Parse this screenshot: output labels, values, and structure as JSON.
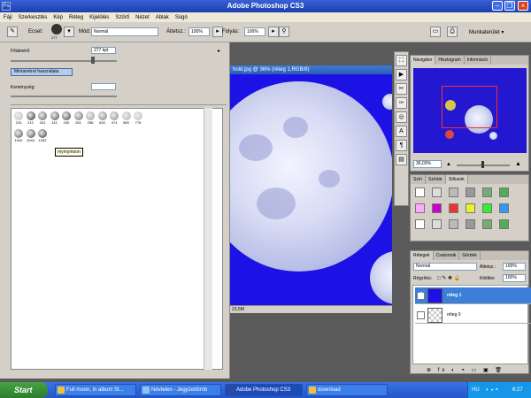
{
  "window": {
    "title": "Adobe Photoshop CS3",
    "app_icon": "Ps"
  },
  "menubar": [
    "Fájl",
    "Szerkesztés",
    "Kép",
    "Réteg",
    "Kijelölés",
    "Szűrő",
    "Nézet",
    "Ablak",
    "Súgó"
  ],
  "options": {
    "brush_label": "Ecset:",
    "brush_size": "277",
    "mode_label": "Mód:",
    "mode_value": "Normál",
    "opacity_label": "Áttetsz.:",
    "opacity_value": "100%",
    "flow_label": "Folyás:",
    "flow_value": "100%",
    "workspace_label": "Munkaterület ▾"
  },
  "brush_panel": {
    "diameter_label": "Főátmérő",
    "diameter_value": "277 kpt",
    "sample_button": "Mintaméret használata",
    "hardness_label": "Keménység:",
    "brushes": [
      "224",
      "212",
      "341",
      "311",
      "240",
      "261",
      "256",
      "640",
      "474",
      "560",
      "776",
      "1042",
      "1944",
      "1032"
    ],
    "tooltip": "mymymoon"
  },
  "document": {
    "title": "hold.jpg @ 36% (réteg 1,RGB/8)",
    "status": "23,5M"
  },
  "navigator": {
    "tabs": [
      "Navigátor",
      "Hisztogram",
      "Információ"
    ],
    "zoom": "36,03%"
  },
  "styles_panel": {
    "tabs": [
      "Szín",
      "Színtár",
      "Stílusok"
    ]
  },
  "layers": {
    "tabs": [
      "Rétegek",
      "Csatornák",
      "Görbék"
    ],
    "blend_mode": "Normál",
    "opacity_label": "Áttetsz.:",
    "opacity_value": "100%",
    "lock_label": "Rögzítés:",
    "fill_label": "Kitöltés:",
    "fill_value": "100%",
    "items": [
      {
        "name": "réteg 1",
        "selected": true
      },
      {
        "name": "réteg 0",
        "selected": false
      }
    ]
  },
  "taskbar": {
    "start": "Start",
    "tasks": [
      "Full moon, in album St...",
      "Névtelen - Jegyzettömb",
      "Adobe Photoshop CS3",
      "download"
    ],
    "lang": "HU",
    "clock": "6:27"
  },
  "colors": {
    "canvas_bg": "#1c12e6",
    "title_blue": "#2c5cb2",
    "selection_blue": "#3c7fd8"
  }
}
